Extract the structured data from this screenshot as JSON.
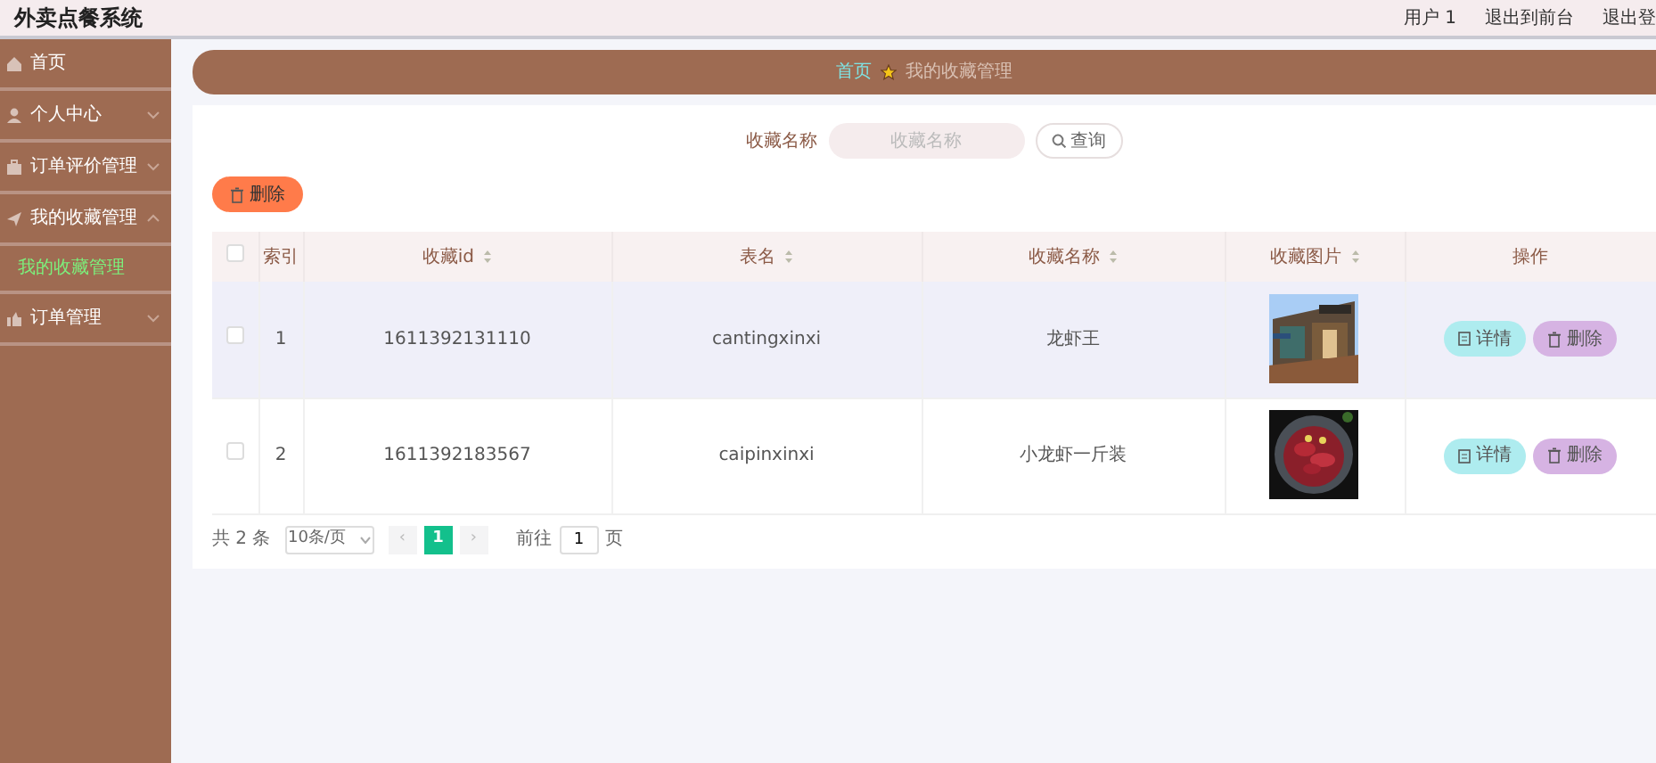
{
  "header": {
    "title": "外卖点餐系统",
    "links": [
      "用户 1",
      "退出到前台",
      "退出登"
    ]
  },
  "sidebar": {
    "items": [
      {
        "label": "首页"
      },
      {
        "label": "个人中心",
        "expandable": true,
        "expanded": false
      },
      {
        "label": "订单评价管理",
        "expandable": true,
        "expanded": false
      },
      {
        "label": "我的收藏管理",
        "expandable": true,
        "expanded": true,
        "children": [
          {
            "label": "我的收藏管理",
            "selected": true
          }
        ]
      },
      {
        "label": "订单管理",
        "expandable": true,
        "expanded": false
      }
    ]
  },
  "breadcrumb": [
    "首页",
    "我的收藏管理"
  ],
  "search": {
    "label": "收藏名称",
    "placeholder": "收藏名称",
    "button": "查询"
  },
  "delete_button": "删除",
  "table": {
    "header_checked": false,
    "columns": [
      {
        "label": "索引",
        "sortable": false
      },
      {
        "label": "收藏id",
        "sortable": true
      },
      {
        "label": "表名",
        "sortable": true
      },
      {
        "label": "收藏名称",
        "sortable": true
      },
      {
        "label": "收藏图片",
        "sortable": true
      },
      {
        "label": "操作",
        "sortable": false
      }
    ],
    "rows": [
      {
        "checked": false,
        "highlighted": true,
        "cells": [
          "1",
          "1611392131110",
          "cantingxinxi",
          "龙虾王"
        ],
        "actions": [
          "详情",
          "删除"
        ]
      },
      {
        "checked": false,
        "highlighted": false,
        "cells": [
          "2",
          "1611392183567",
          "caipinxinxi",
          "小龙虾一斤装"
        ],
        "actions": [
          "详情",
          "删除"
        ]
      }
    ]
  },
  "pagination": {
    "total": "共 2 条",
    "page_size": "10条/页",
    "prev": "‹",
    "next": "›",
    "pages": [
      {
        "label": "1",
        "selected": true
      }
    ],
    "goto_label": "前往",
    "goto_value": "1",
    "goto_suffix": "页"
  }
}
